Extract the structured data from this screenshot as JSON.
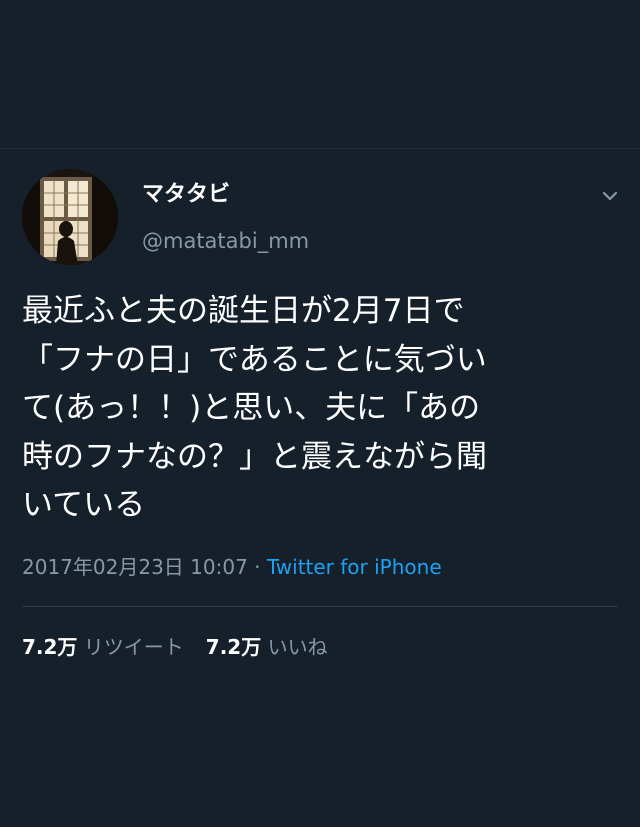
{
  "tweet": {
    "display_name": "マタタビ",
    "handle": "@matatabi_mm",
    "text_lines": [
      "最近ふと夫の誕生日が2月7日で",
      "「フナの日」であることに気づい",
      "て(あっ！！)と思い、夫に「あの",
      "時のフナなの？」と震えながら聞",
      "いている"
    ],
    "timestamp": "2017年02月23日 10:07",
    "separator": "·",
    "source": "Twitter for iPhone",
    "retweets_count": "7.2万",
    "retweets_label": "リツイート",
    "likes_count": "7.2万",
    "likes_label": "いいね"
  },
  "icons": {
    "menu": "chevron-down-icon"
  },
  "colors": {
    "background": "#15202b",
    "text": "#ffffff",
    "secondary": "#8899a6",
    "link": "#1da1f2"
  }
}
